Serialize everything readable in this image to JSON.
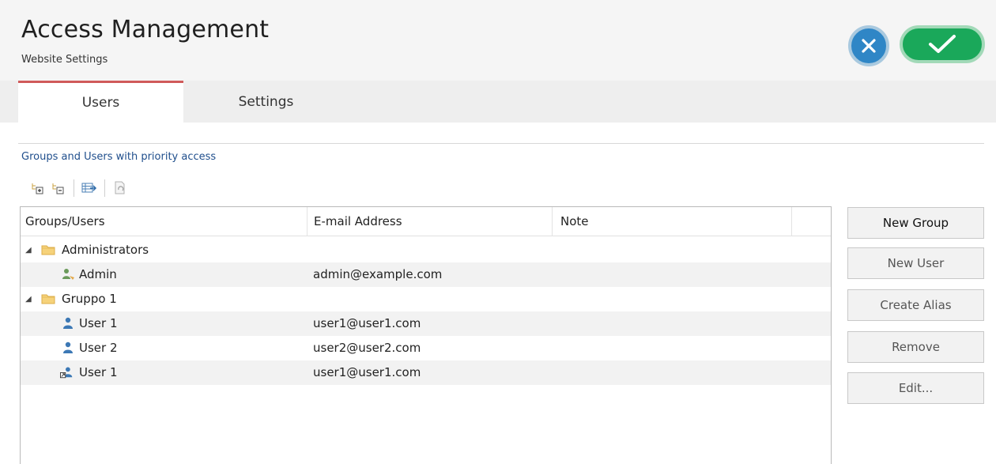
{
  "header": {
    "title": "Access Management",
    "subtitle": "Website Settings"
  },
  "tabs": [
    {
      "label": "Users",
      "active": true
    },
    {
      "label": "Settings",
      "active": false
    }
  ],
  "section_label": "Groups and Users with priority access",
  "toolbar": {
    "icons": [
      "expand-all-icon",
      "collapse-all-icon",
      "export-icon",
      "refresh-icon"
    ]
  },
  "grid": {
    "columns": [
      "Groups/Users",
      "E-mail Address",
      "Note"
    ],
    "rows": [
      {
        "type": "group",
        "name": "Administrators",
        "email": "",
        "note": "",
        "icon": "folder-icon"
      },
      {
        "type": "user",
        "name": "Admin",
        "email": "admin@example.com",
        "note": "",
        "icon": "admin-user-icon"
      },
      {
        "type": "group",
        "name": "Gruppo 1",
        "email": "",
        "note": "",
        "icon": "folder-icon"
      },
      {
        "type": "user",
        "name": "User 1",
        "email": "user1@user1.com",
        "note": "",
        "icon": "user-icon"
      },
      {
        "type": "user",
        "name": "User 2",
        "email": "user2@user2.com",
        "note": "",
        "icon": "user-icon"
      },
      {
        "type": "alias",
        "name": "User 1",
        "email": "user1@user1.com",
        "note": "",
        "icon": "alias-user-icon"
      }
    ]
  },
  "actions": {
    "new_group": "New Group",
    "new_user": "New User",
    "create_alias": "Create Alias",
    "remove": "Remove",
    "edit": "Edit..."
  },
  "colors": {
    "tab_accent": "#d05a5a",
    "section_label": "#1f4e8c",
    "cancel_button": "#2f86c6",
    "confirm_button": "#1aa85a"
  }
}
